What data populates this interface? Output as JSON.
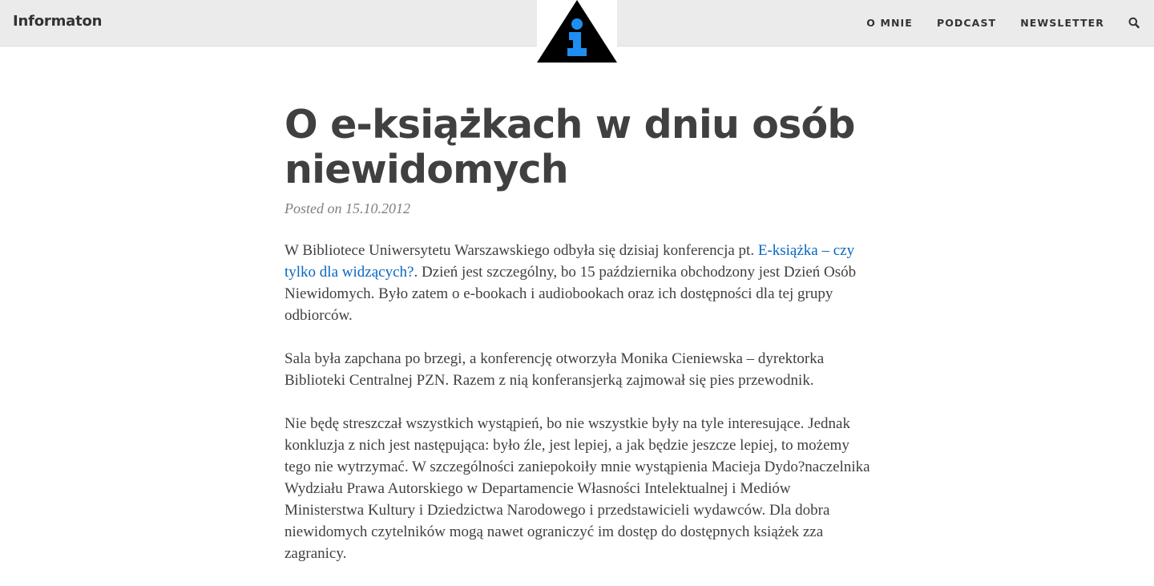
{
  "site": {
    "title": "Informaton",
    "logo_icon": "info-triangle-logo",
    "logo_colors": {
      "triangle": "#000000",
      "glyph": "#1e8ff0"
    }
  },
  "nav": {
    "items": [
      {
        "label": "O MNIE"
      },
      {
        "label": "PODCAST"
      },
      {
        "label": "NEWSLETTER"
      }
    ],
    "search_icon": "search-icon"
  },
  "post": {
    "title": "O e-książkach w dniu osób niewidomych",
    "meta": "Posted on 15.10.2012",
    "paragraphs": [
      {
        "before_link": "W Bibliotece Uniwersytetu Warszawskiego odbyła się dzisiaj konferencja pt. ",
        "link_text": "E-książka – czy tylko dla widzących?",
        "after_link": ". Dzień jest szczególny, bo 15 października obchodzony jest Dzień Osób Niewidomych. Było zatem o e-bookach i audiobookach oraz ich dostępności dla tej grupy odbiorców."
      },
      {
        "text": "Sala była zapchana po brzegi, a konferencję otworzyła Monika Cieniewska – dyrektorka Biblioteki Centralnej PZN. Razem z nią konferansjerką zajmował się pies przewodnik."
      },
      {
        "text": "Nie będę streszczał wszystkich wystąpień, bo nie wszystkie były na tyle interesujące. Jednak konkluzja z nich jest następująca: było źle, jest lepiej, a jak będzie jeszcze lepiej, to możemy tego nie wytrzymać. W szczególności zaniepokoiły mnie wystąpienia Macieja Dydo?naczelnika Wydziału Prawa Autorskiego w Departamencie Własności Intelektualnej i Mediów Ministerstwa Kultury i Dziedzictwa Narodowego i przedstawicieli wydawców. Dla dobra niewidomych czytelników mogą nawet ograniczyć im dostęp do dostępnych książek zza zagranicy."
      }
    ]
  },
  "colors": {
    "topbar_bg": "#ebebeb",
    "text": "#404040",
    "meta": "#808080",
    "link": "#0a66c2"
  }
}
